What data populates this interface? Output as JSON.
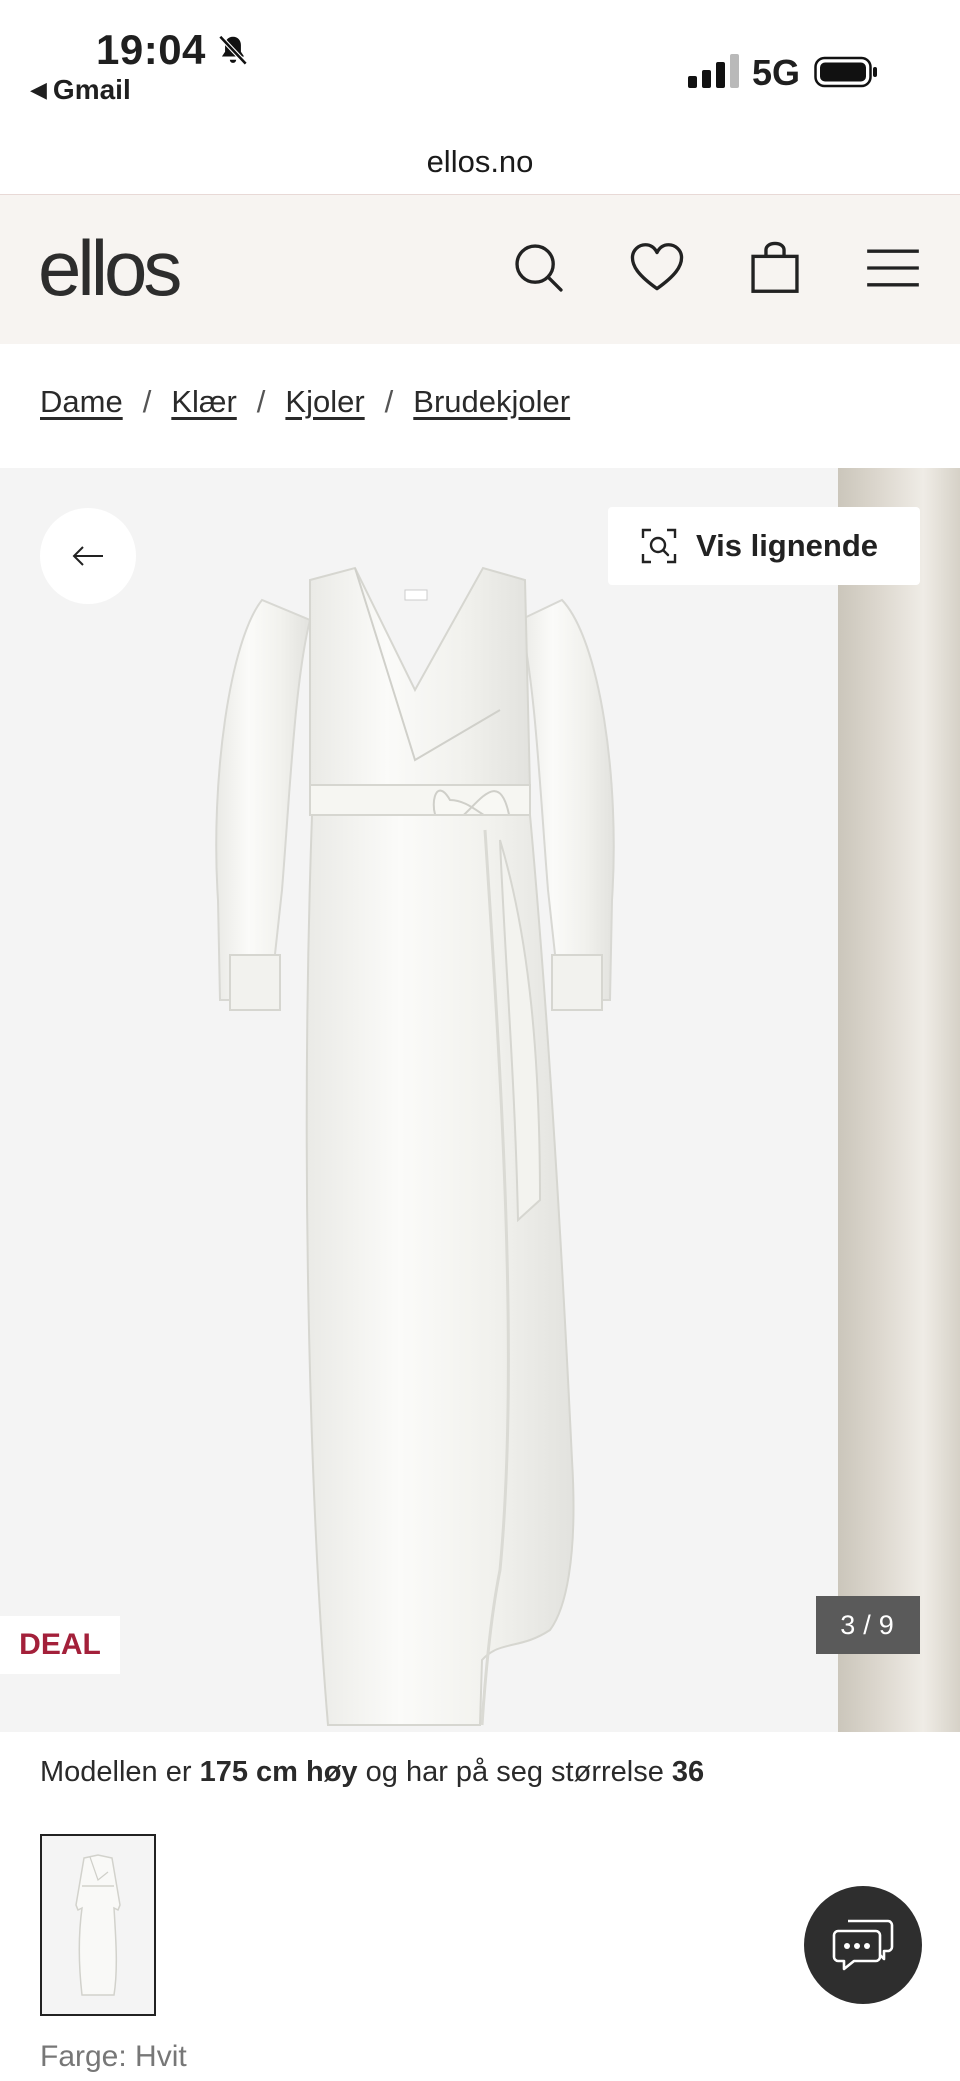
{
  "status_bar": {
    "time": "19:04",
    "back_app": "Gmail",
    "network": "5G",
    "icons": [
      "bell-off-icon",
      "signal-icon",
      "battery-icon"
    ]
  },
  "browser": {
    "url": "ellos.no"
  },
  "header": {
    "logo": "ellos",
    "icons": [
      "search-icon",
      "heart-icon",
      "bag-icon",
      "menu-icon"
    ]
  },
  "breadcrumb": {
    "items": [
      "Dame",
      "Klær",
      "Kjoler",
      "Brudekjoler"
    ],
    "separator": "/"
  },
  "gallery": {
    "similar_label": "Vis lignende",
    "badge": "DEAL",
    "current": "3",
    "total": "9",
    "counter_sep": "/"
  },
  "model_info": {
    "prefix": "Modellen er",
    "height": "175 cm høy",
    "middle": "og har på seg størrelse",
    "size": "36"
  },
  "color": {
    "label": "Farge: Hvit"
  },
  "colors": {
    "deal": "#a3203a",
    "header_bg": "#f7f4f1",
    "counter_bg": "#5a5a5a",
    "chat_bg": "#2e2e2e"
  }
}
